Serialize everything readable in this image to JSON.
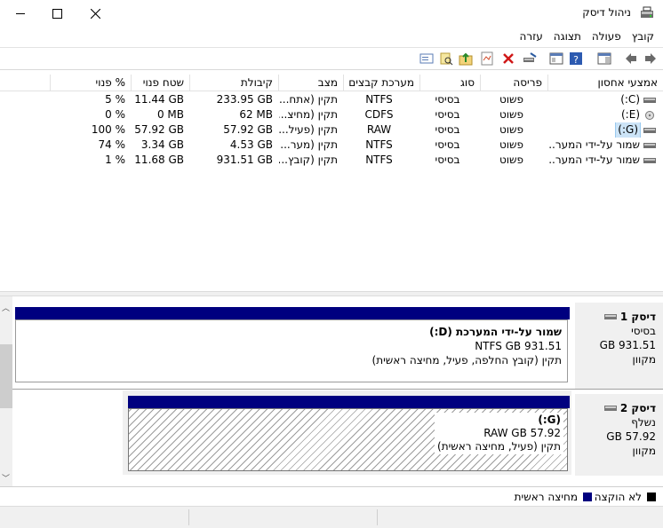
{
  "window": {
    "title": "ניהול דיסק",
    "minimize": "—",
    "maximize": "☐",
    "close": "✕"
  },
  "menu": [
    "קובץ",
    "פעולה",
    "תצוגה",
    "עזרה"
  ],
  "table": {
    "headers": [
      "אמצעי אחסון",
      "פריסה",
      "סוג",
      "מערכת קבצים",
      "מצב",
      "קיבולת",
      "שטח פנוי",
      "% פנוי"
    ],
    "rows": [
      [
        "(C:)",
        "פשוט",
        "בסיסי",
        "NTFS",
        "תקין (אתח...",
        "233.95 GB",
        "11.44 GB",
        "5 %"
      ],
      [
        "(E:)",
        "פשוט",
        "בסיסי",
        "CDFS",
        "תקין (מחיצ...",
        "62 MB",
        "0 MB",
        "0 %"
      ],
      [
        "(G:)",
        "פשוט",
        "בסיסי",
        "RAW",
        "תקין (פעיל...",
        "57.92 GB",
        "57.92 GB",
        "100 %"
      ],
      [
        "שמור על-ידי המער...",
        "פשוט",
        "בסיסי",
        "NTFS",
        "תקין (מער...",
        "4.53 GB",
        "3.34 GB",
        "74 %"
      ],
      [
        "שמור על-ידי המער...",
        "פשוט",
        "בסיסי",
        "NTFS",
        "תקין (קובץ...",
        "931.51 GB",
        "11.68 GB",
        "1 %"
      ]
    ]
  },
  "disks": [
    {
      "name": "דיסק 1",
      "type": "בסיסי",
      "size": "931.51 GB",
      "status": "מקוון",
      "partition": {
        "title": "שמור על-ידי המערכת  (D:)",
        "detail": "931.51 NTFS GB",
        "status": "תקין (קובץ החלפה, פעיל, מחיצה ראשית)"
      }
    },
    {
      "name": "דיסק 2",
      "type": "נשלף",
      "size": "57.92 GB",
      "status": "מקוון",
      "partition": {
        "title": "(G:)",
        "detail": "57.92 RAW GB",
        "status": "תקין (פעיל, מחיצה ראשית)"
      }
    }
  ],
  "legend": {
    "unallocated": "לא הוקצה",
    "primary": "מחיצה ראשית"
  },
  "colors": {
    "partition_bar": "#00007f",
    "selection": "#cce4f7",
    "unallocated": "#000000"
  }
}
